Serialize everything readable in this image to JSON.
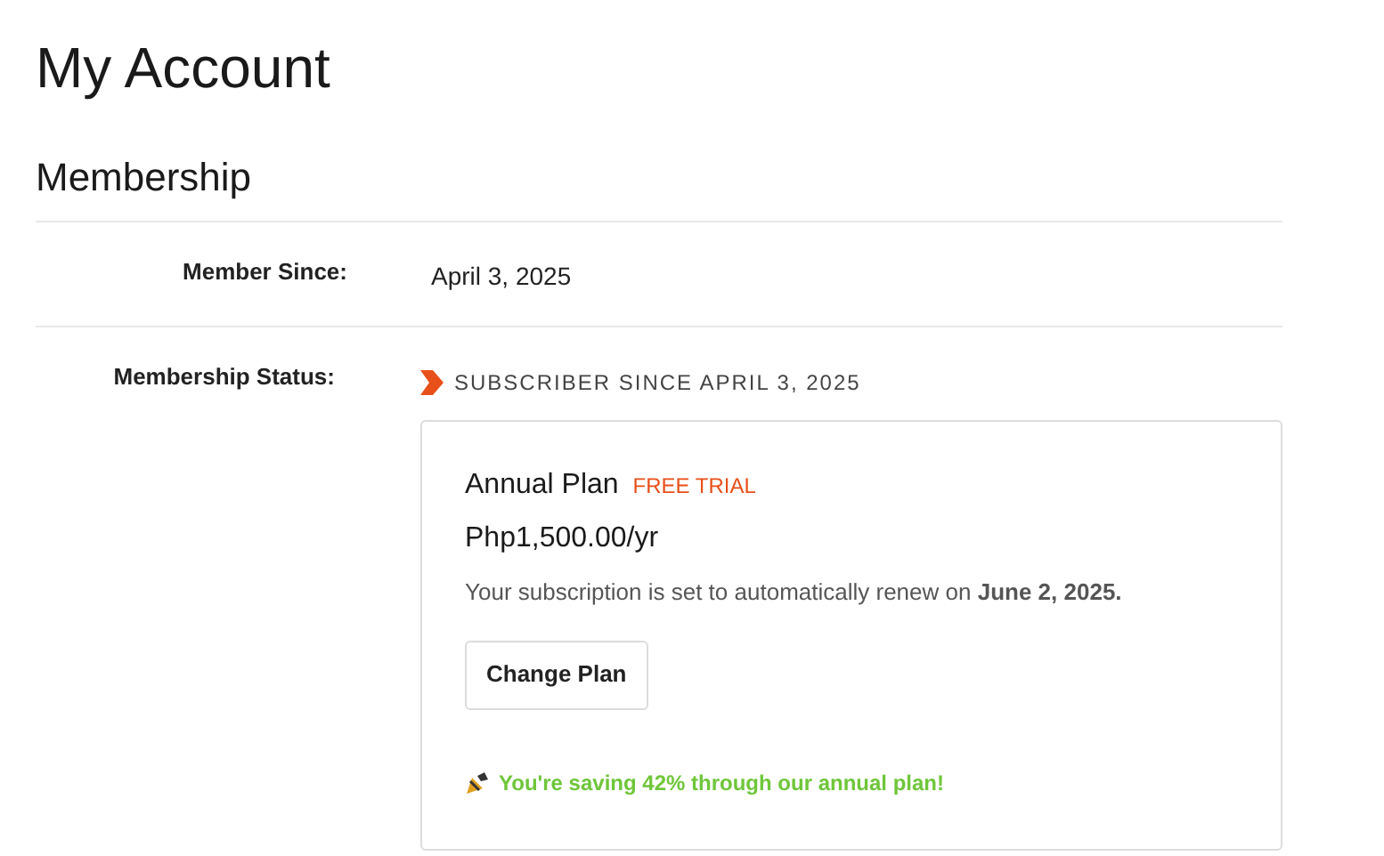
{
  "page_title": "My Account",
  "section_title": "Membership",
  "rows": [
    {
      "label": "Member Since:",
      "value": "April 3, 2025"
    },
    {
      "label": "Membership Status:",
      "status": "SUBSCRIBER SINCE APRIL 3, 2025"
    }
  ],
  "plan": {
    "name": "Annual Plan",
    "badge": "FREE TRIAL",
    "price": "Php1,500.00/yr",
    "renewal": "Your subscription is set to automatically renew on **June 2, 2025.**",
    "button": "Change Plan",
    "savings": "You're saving 42% through our annual plan!"
  }
}
